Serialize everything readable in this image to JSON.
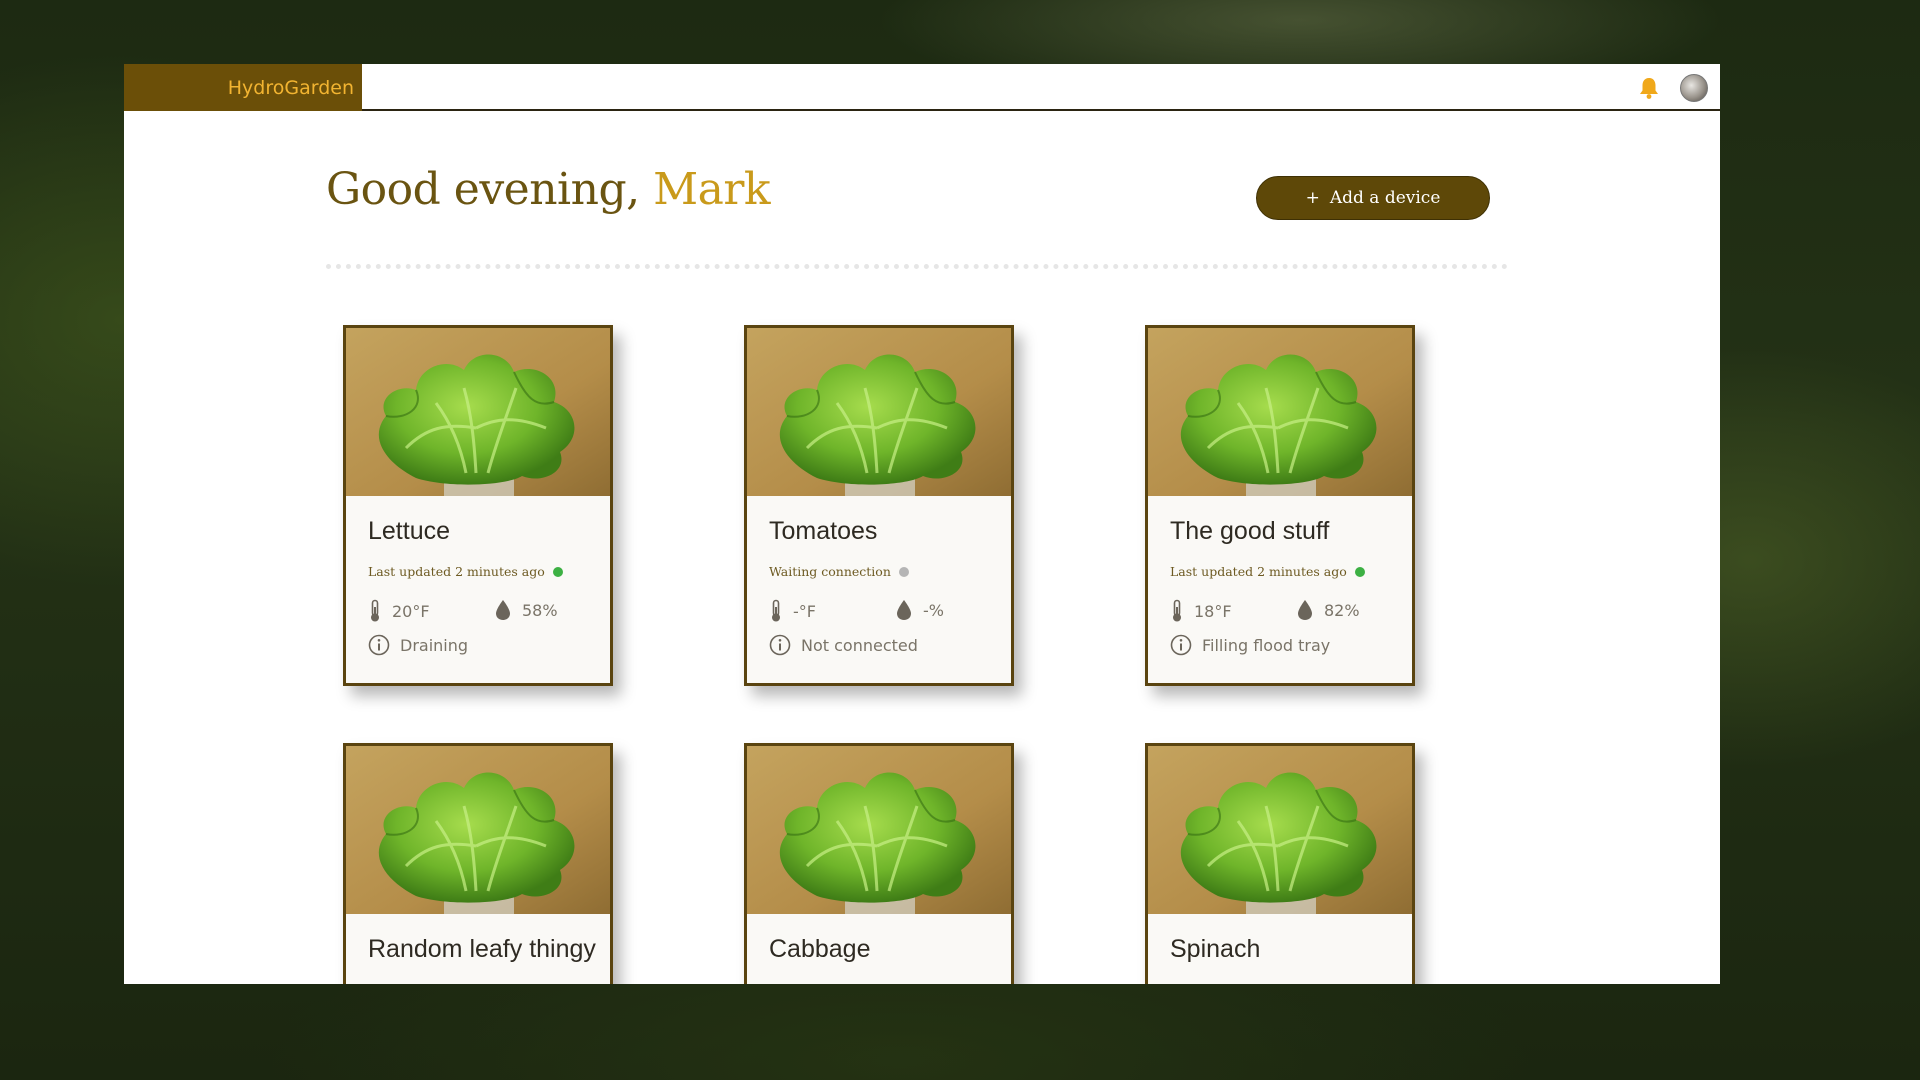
{
  "app": {
    "brand": "HydroGarden"
  },
  "header": {
    "greeting_prefix": "Good evening, ",
    "user_name": "Mark"
  },
  "actions": {
    "add_device_icon": "+",
    "add_device_label": "Add a device"
  },
  "icons": {
    "notifications": "bell-icon",
    "temperature": "thermometer-icon",
    "humidity": "droplet-icon",
    "info": "info-icon"
  },
  "colors": {
    "brand_bg": "#6b4f08",
    "brand_text": "#f2b431",
    "accent_name": "#c99a1b",
    "online": "#3cb043",
    "offline": "#b5b5b5"
  },
  "devices": [
    {
      "name": "Lettuce",
      "status": "Last updated 2 minutes ago",
      "online": true,
      "temperature": "20°F",
      "humidity": "58%",
      "state": "Draining"
    },
    {
      "name": "Tomatoes",
      "status": "Waiting connection",
      "online": false,
      "temperature": "-°F",
      "humidity": "-%",
      "state": "Not connected"
    },
    {
      "name": "The good stuff",
      "status": "Last updated 2 minutes ago",
      "online": true,
      "temperature": "18°F",
      "humidity": "82%",
      "state": "Filling flood tray"
    },
    {
      "name": "Random leafy thingy"
    },
    {
      "name": "Cabbage"
    },
    {
      "name": "Spinach"
    }
  ]
}
